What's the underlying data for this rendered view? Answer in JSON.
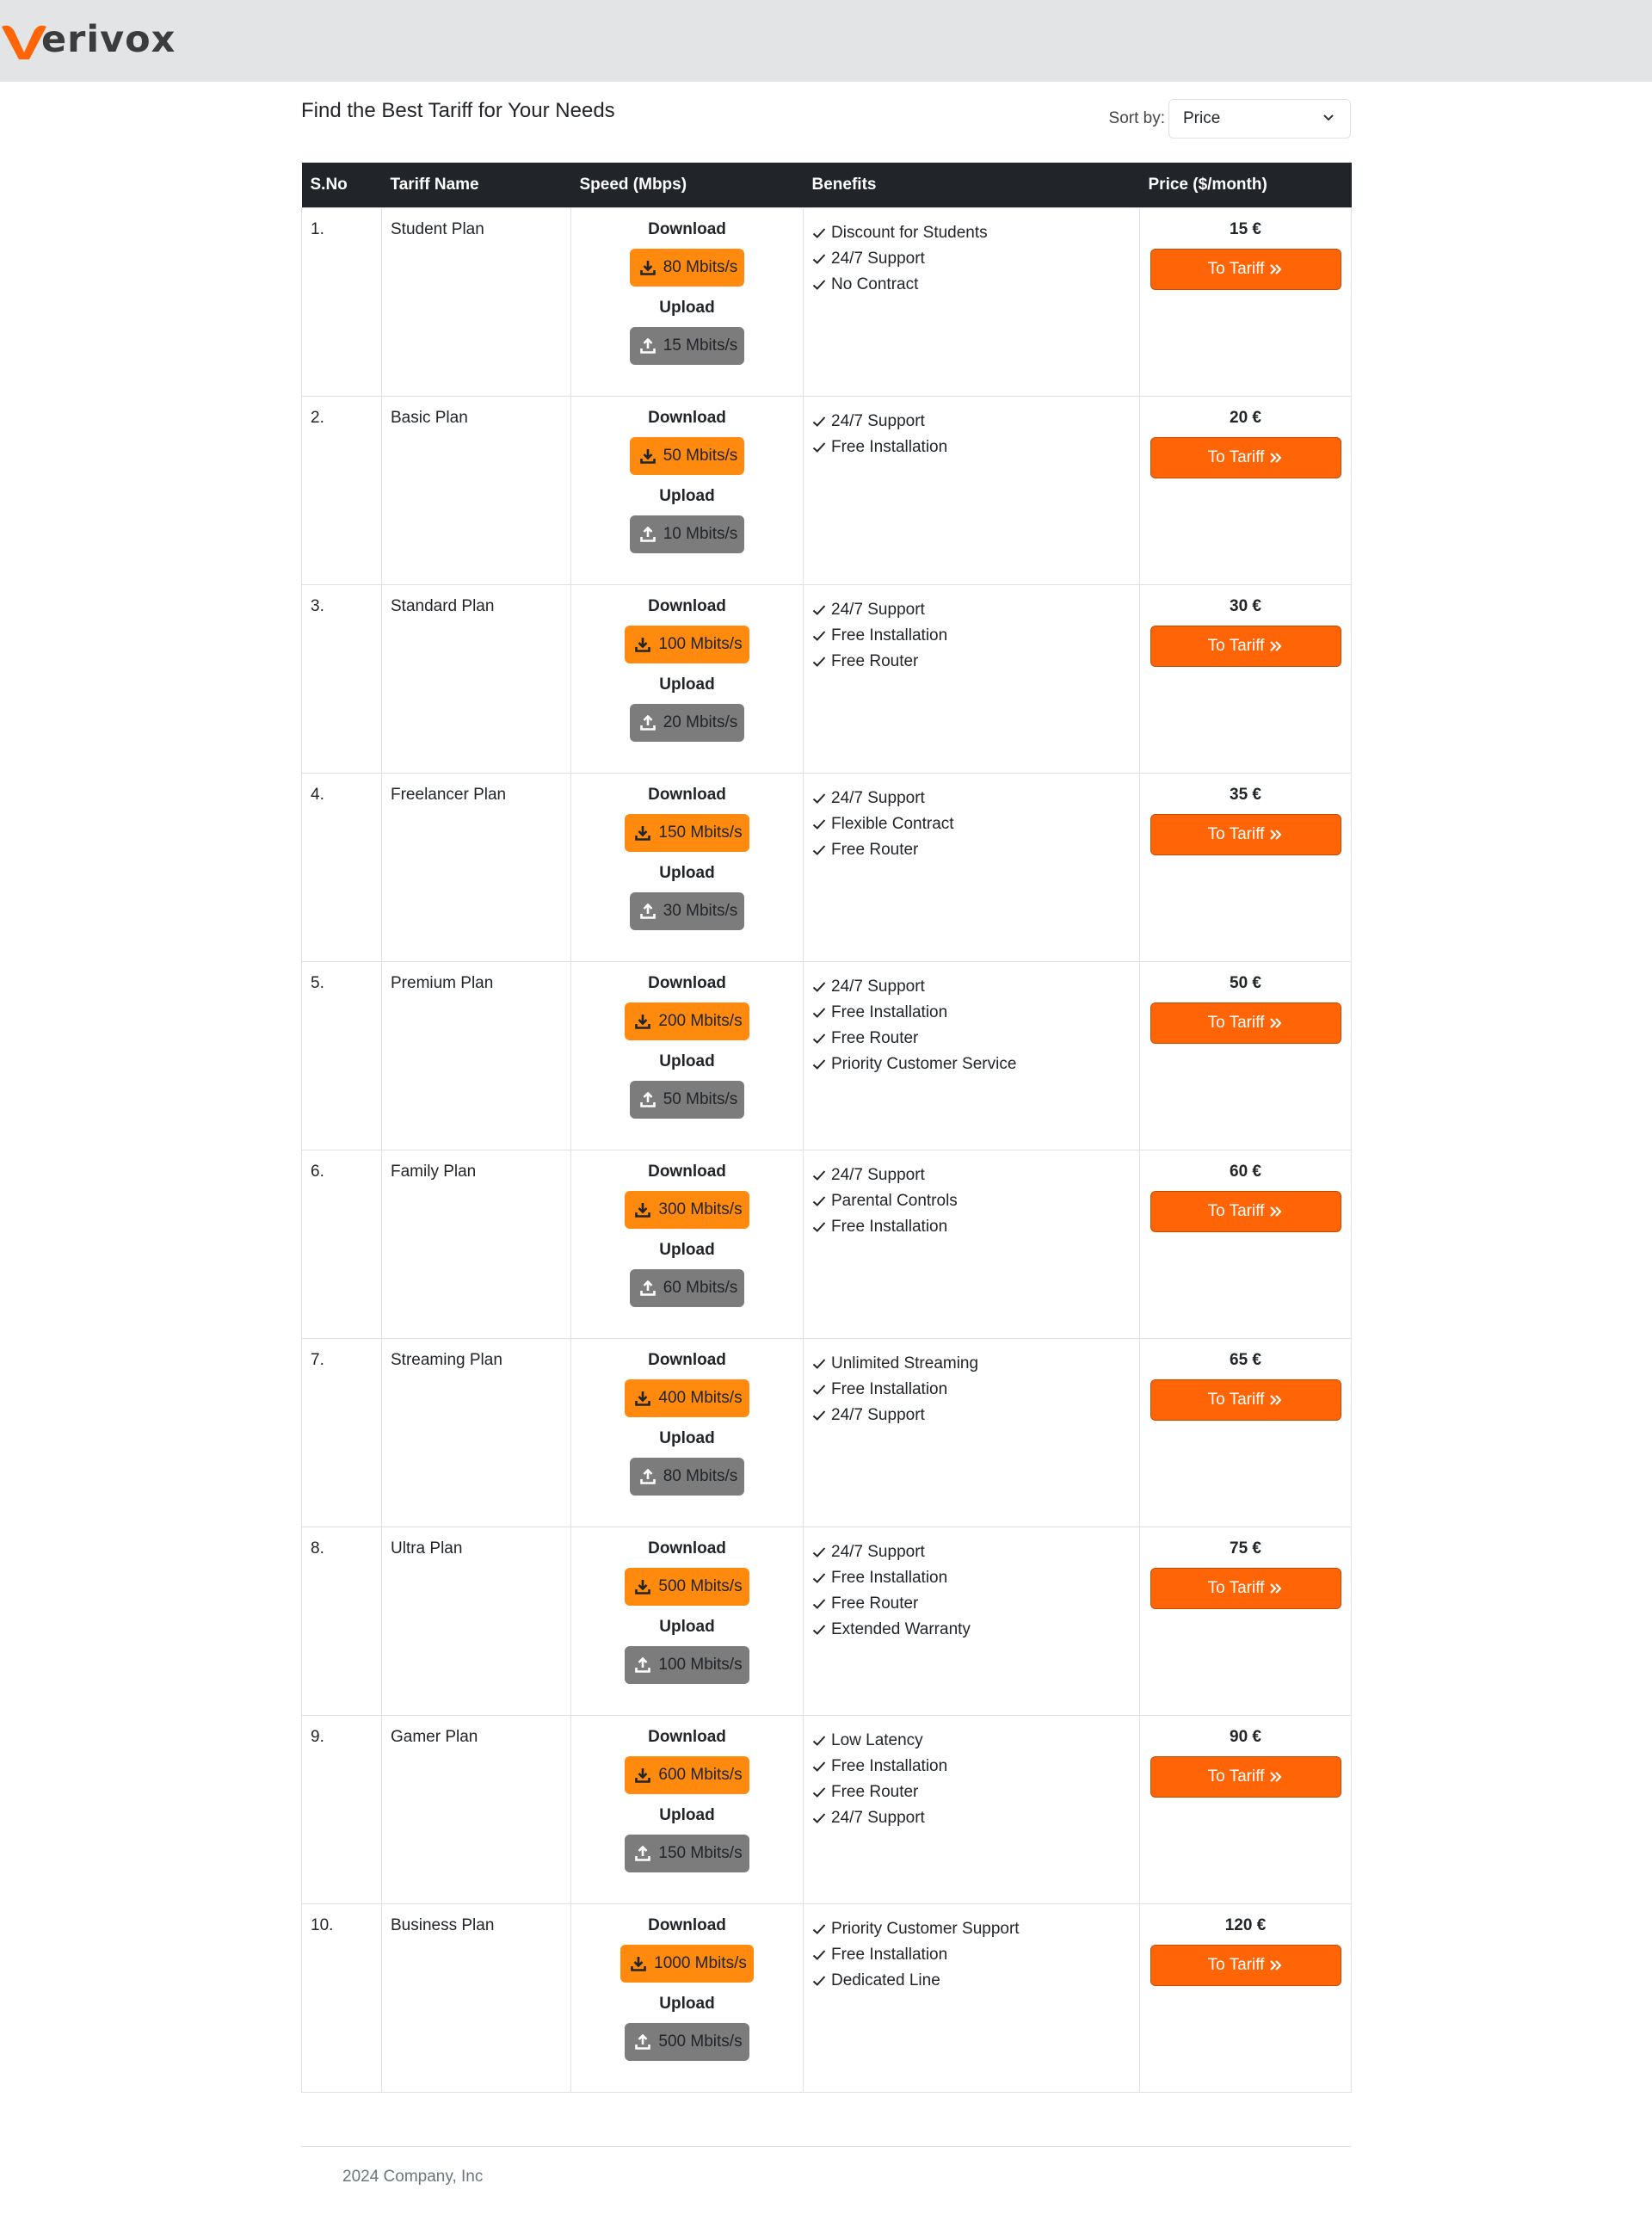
{
  "brand": {
    "name": "erivox",
    "accent": "#ff6406"
  },
  "page": {
    "title": "Find the Best Tariff for Your Needs"
  },
  "sort": {
    "label": "Sort by:",
    "selected": "Price"
  },
  "table": {
    "headers": [
      "S.No",
      "Tariff Name",
      "Speed (Mbps)",
      "Benefits",
      "Price ($/month)"
    ],
    "download_label": "Download",
    "upload_label": "Upload",
    "button_label": "To Tariff",
    "rows": [
      {
        "sno": "1.",
        "name": "Student Plan",
        "download": "80 Mbits/s",
        "upload": "15 Mbits/s",
        "benefits": [
          "Discount for Students",
          "24/7 Support",
          "No Contract"
        ],
        "price": "15 €"
      },
      {
        "sno": "2.",
        "name": "Basic Plan",
        "download": "50 Mbits/s",
        "upload": "10 Mbits/s",
        "benefits": [
          "24/7 Support",
          "Free Installation"
        ],
        "price": "20 €"
      },
      {
        "sno": "3.",
        "name": "Standard Plan",
        "download": "100 Mbits/s",
        "upload": "20 Mbits/s",
        "benefits": [
          "24/7 Support",
          "Free Installation",
          "Free Router"
        ],
        "price": "30 €"
      },
      {
        "sno": "4.",
        "name": "Freelancer Plan",
        "download": "150 Mbits/s",
        "upload": "30 Mbits/s",
        "benefits": [
          "24/7 Support",
          "Flexible Contract",
          "Free Router"
        ],
        "price": "35 €"
      },
      {
        "sno": "5.",
        "name": "Premium Plan",
        "download": "200 Mbits/s",
        "upload": "50 Mbits/s",
        "benefits": [
          "24/7 Support",
          "Free Installation",
          "Free Router",
          "Priority Customer Service"
        ],
        "price": "50 €"
      },
      {
        "sno": "6.",
        "name": "Family Plan",
        "download": "300 Mbits/s",
        "upload": "60 Mbits/s",
        "benefits": [
          "24/7 Support",
          "Parental Controls",
          "Free Installation"
        ],
        "price": "60 €"
      },
      {
        "sno": "7.",
        "name": "Streaming Plan",
        "download": "400 Mbits/s",
        "upload": "80 Mbits/s",
        "benefits": [
          "Unlimited Streaming",
          "Free Installation",
          "24/7 Support"
        ],
        "price": "65 €"
      },
      {
        "sno": "8.",
        "name": "Ultra Plan",
        "download": "500 Mbits/s",
        "upload": "100 Mbits/s",
        "benefits": [
          "24/7 Support",
          "Free Installation",
          "Free Router",
          "Extended Warranty"
        ],
        "price": "75 €"
      },
      {
        "sno": "9.",
        "name": "Gamer Plan",
        "download": "600 Mbits/s",
        "upload": "150 Mbits/s",
        "benefits": [
          "Low Latency",
          "Free Installation",
          "Free Router",
          "24/7 Support"
        ],
        "price": "90 €"
      },
      {
        "sno": "10.",
        "name": "Business Plan",
        "download": "1000 Mbits/s",
        "upload": "500 Mbits/s",
        "benefits": [
          "Priority Customer Support",
          "Free Installation",
          "Dedicated Line"
        ],
        "price": "120 €"
      }
    ]
  },
  "footer": {
    "text": "2024 Company, Inc"
  },
  "colors": {
    "download_badge": "#ff8a0d",
    "upload_badge": "#7c7c7c",
    "header_bg": "#212529",
    "topbar_bg": "#e3e4e6"
  },
  "icons": {
    "download": "download-icon",
    "upload": "upload-icon",
    "check": "check-icon",
    "double_chevron": "double-chevron-right-icon",
    "sort_caret": "chevron-down-icon"
  }
}
